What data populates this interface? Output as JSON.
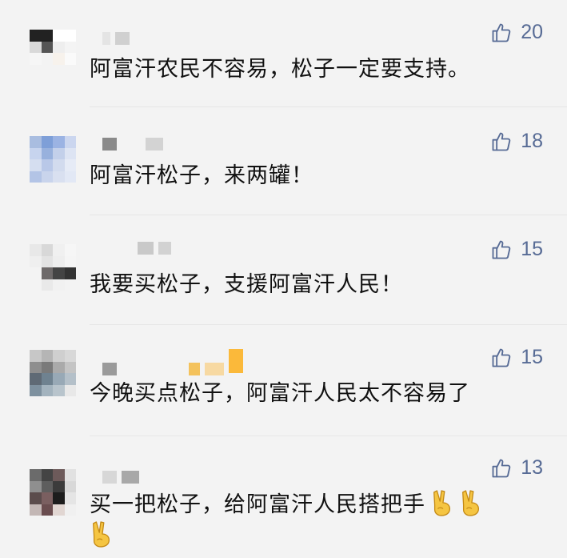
{
  "comments": [
    {
      "likes": "20",
      "text": "阿富汗农民不容易，松子一定要支持。"
    },
    {
      "likes": "18",
      "text": "阿富汗松子，来两罐！"
    },
    {
      "likes": "15",
      "text": "我要买松子，支援阿富汗人民！"
    },
    {
      "likes": "15",
      "text": "今晚买点松子，阿富汗人民太不容易了"
    },
    {
      "likes": "13",
      "text": "买一把松子，给阿富汗人民搭把手"
    }
  ],
  "icons": {
    "like": "thumbs-up-icon",
    "victory": "victory-hand-emoji"
  },
  "colors": {
    "like_accent": "#576b95",
    "text": "#111111",
    "background": "#f3f3f3"
  }
}
